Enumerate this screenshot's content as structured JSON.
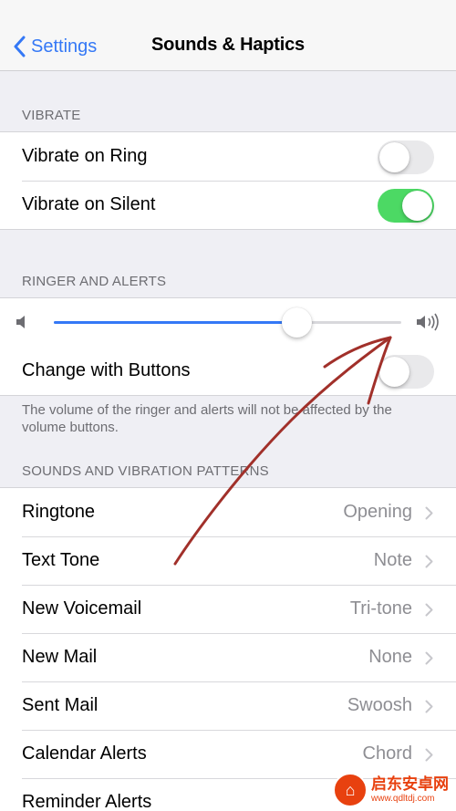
{
  "nav": {
    "back_label": "Settings",
    "title": "Sounds & Haptics"
  },
  "sections": {
    "vibrate_header": "VIBRATE",
    "ringer_header": "RINGER AND ALERTS",
    "patterns_header": "SOUNDS AND VIBRATION PATTERNS"
  },
  "vibrate": [
    {
      "label": "Vibrate on Ring",
      "on": false
    },
    {
      "label": "Vibrate on Silent",
      "on": true
    }
  ],
  "ringer": {
    "volume_level": 0.7,
    "change_with_buttons_label": "Change with Buttons",
    "change_with_buttons_on": false,
    "note": "The volume of the ringer and alerts will not be affected by the volume buttons."
  },
  "patterns": [
    {
      "label": "Ringtone",
      "value": "Opening"
    },
    {
      "label": "Text Tone",
      "value": "Note"
    },
    {
      "label": "New Voicemail",
      "value": "Tri-tone"
    },
    {
      "label": "New Mail",
      "value": "None"
    },
    {
      "label": "Sent Mail",
      "value": "Swoosh"
    },
    {
      "label": "Calendar Alerts",
      "value": "Chord"
    },
    {
      "label": "Reminder Alerts",
      "value": ""
    }
  ],
  "watermark": {
    "name": "启东安卓网",
    "url": "www.qdltdj.com"
  },
  "colors": {
    "accent": "#3478f6",
    "toggle_on": "#4cd964",
    "annotation": "#a1302a"
  },
  "icons": {
    "back": "chevron-left-icon",
    "volume_low": "speaker-low-icon",
    "volume_high": "speaker-high-icon",
    "disclosure": "chevron-right-icon"
  }
}
